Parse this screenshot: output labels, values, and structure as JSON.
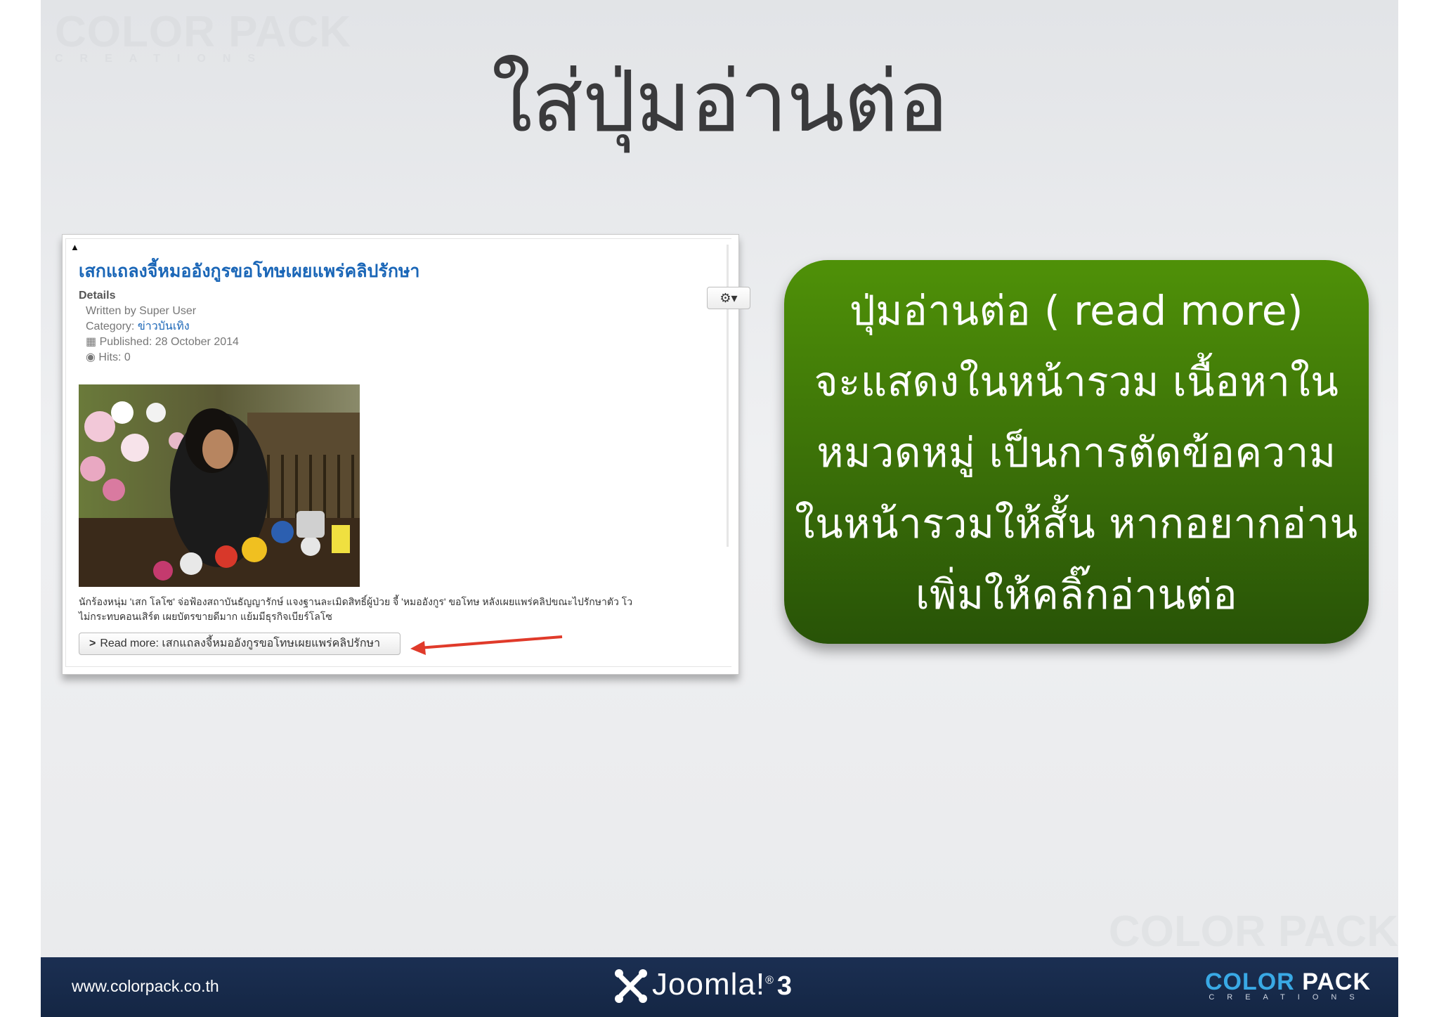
{
  "slide": {
    "title": "ใส่ปุ่มอ่านต่อ",
    "watermark_top": "COLOR PACK",
    "watermark_top_sub": "CREATIONS",
    "watermark_bottom": "COLOR PACK"
  },
  "article": {
    "title": "เสกแถลงจี้หมออังกูรขอโทษเผยแพร่คลิปรักษา",
    "gear_button": "⚙▾",
    "details_label": "Details",
    "written_by": "Written by Super User",
    "category_prefix": "Category: ",
    "category": "ข่าวบันเทิง",
    "published": "Published: 28 October 2014",
    "hits": "Hits: 0",
    "intro_line1": "นักร้องหนุ่ม 'เสก โลโซ' จ่อฟ้องสถาบันธัญญารักษ์ แจงฐานละเมิดสิทธิ์ผู้ป่วย จี้ 'หมออังกูร' ขอโทษ หลังเผยแพร่คลิปขณะไปรักษาตัว โว",
    "intro_line2": "ไม่กระทบคอนเสิร์ต เผยบัตรขายดีมาก แย้มมีธุรกิจเบียร์โลโซ",
    "read_more": "Read more: เสกแถลงจี้หมออังกูรขอโทษเผยแพร่คลิปรักษา"
  },
  "callout": {
    "lines": [
      "ปุ่มอ่านต่อ ( read more)",
      "จะแสดงในหน้ารวม เนื้อหาใน",
      "หมวดหมู่   เป็นการตัดข้อความ",
      "ในหน้ารวมให้สั้น หากอยากอ่าน",
      "เพิ่มให้คลิ๊กอ่านต่อ"
    ]
  },
  "footer": {
    "url": "www.colorpack.co.th",
    "joomla_name": "Joomla!",
    "joomla_reg": "®",
    "joomla_version": "3",
    "brand_color": "COLOR",
    "brand_pack": "PACK",
    "brand_sub": "CREATIONS"
  },
  "colors": {
    "callout_top": "#4f9108",
    "callout_bottom": "#285307",
    "footer_bg": "#1b2f52",
    "link_blue": "#1a66b7",
    "arrow_red": "#e03a2a"
  }
}
